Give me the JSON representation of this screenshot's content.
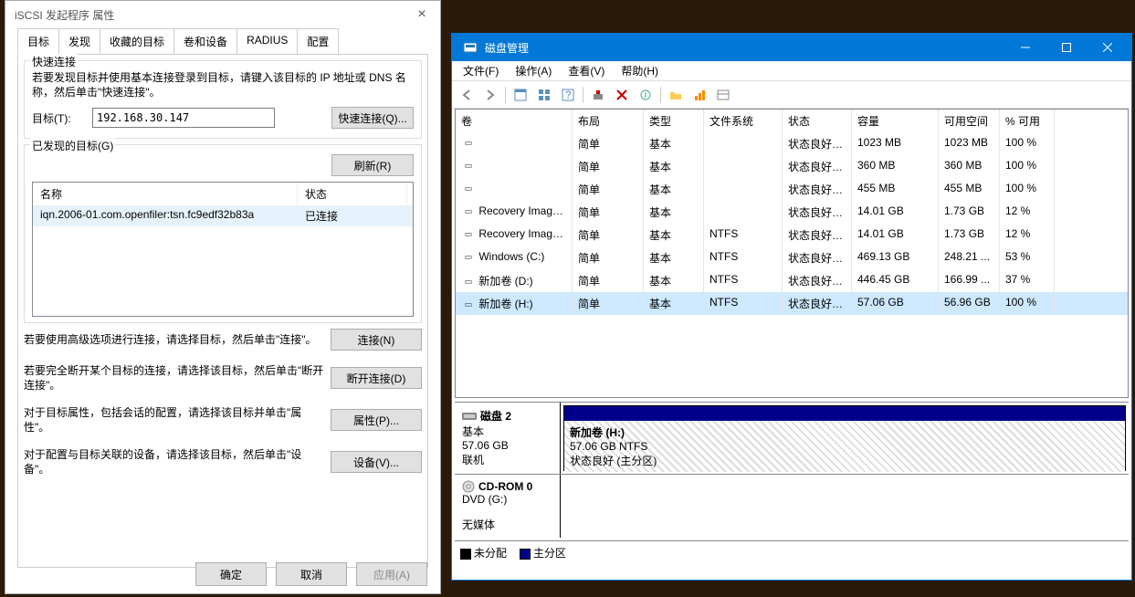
{
  "iscsi": {
    "title": "iSCSI 发起程序 属性",
    "tabs": [
      "目标",
      "发现",
      "收藏的目标",
      "卷和设备",
      "RADIUS",
      "配置"
    ],
    "quick_connect": {
      "group_title": "快速连接",
      "help": "若要发现目标并使用基本连接登录到目标，请键入该目标的 IP 地址或 DNS 名称，然后单击\"快速连接\"。",
      "target_label": "目标(T):",
      "target_value": "192.168.30.147",
      "quick_btn": "快速连接(Q)..."
    },
    "discovered": {
      "group_title": "已发现的目标(G)",
      "refresh_btn": "刷新(R)",
      "col_name": "名称",
      "col_status": "状态",
      "row_name": "iqn.2006-01.com.openfiler:tsn.fc9edf32b83a",
      "row_status": "已连接"
    },
    "actions": {
      "connect_help": "若要使用高级选项进行连接，请选择目标，然后单击\"连接\"。",
      "connect_btn": "连接(N)",
      "disconnect_help": "若要完全断开某个目标的连接，请选择该目标，然后单击\"断开连接\"。",
      "disconnect_btn": "断开连接(D)",
      "props_help": "对于目标属性，包括会话的配置，请选择该目标并单击\"属性\"。",
      "props_btn": "属性(P)...",
      "devices_help": "对于配置与目标关联的设备，请选择该目标，然后单击\"设备\"。",
      "devices_btn": "设备(V)..."
    },
    "footer": {
      "ok": "确定",
      "cancel": "取消",
      "apply": "应用(A)"
    }
  },
  "dm": {
    "title": "磁盘管理",
    "menus": [
      "文件(F)",
      "操作(A)",
      "查看(V)",
      "帮助(H)"
    ],
    "cols": [
      "卷",
      "布局",
      "类型",
      "文件系统",
      "状态",
      "容量",
      "可用空间",
      "% 可用"
    ],
    "rows": [
      {
        "vol": "",
        "layout": "简单",
        "type": "基本",
        "fs": "",
        "status": "状态良好 (...",
        "cap": "1023 MB",
        "free": "1023 MB",
        "pct": "100 %"
      },
      {
        "vol": "",
        "layout": "简单",
        "type": "基本",
        "fs": "",
        "status": "状态良好 (...",
        "cap": "360 MB",
        "free": "360 MB",
        "pct": "100 %"
      },
      {
        "vol": "",
        "layout": "简单",
        "type": "基本",
        "fs": "",
        "status": "状态良好 (...",
        "cap": "455 MB",
        "free": "455 MB",
        "pct": "100 %"
      },
      {
        "vol": "Recovery Image ...",
        "layout": "简单",
        "type": "基本",
        "fs": "",
        "status": "状态良好 (...",
        "cap": "14.01 GB",
        "free": "1.73 GB",
        "pct": "12 %"
      },
      {
        "vol": "Recovery Image ...",
        "layout": "简单",
        "type": "基本",
        "fs": "NTFS",
        "status": "状态良好 (...",
        "cap": "14.01 GB",
        "free": "1.73 GB",
        "pct": "12 %"
      },
      {
        "vol": "Windows (C:)",
        "layout": "简单",
        "type": "基本",
        "fs": "NTFS",
        "status": "状态良好 (...",
        "cap": "469.13 GB",
        "free": "248.21 ...",
        "pct": "53 %"
      },
      {
        "vol": "新加卷 (D:)",
        "layout": "简单",
        "type": "基本",
        "fs": "NTFS",
        "status": "状态良好 (...",
        "cap": "446.45 GB",
        "free": "166.99 ...",
        "pct": "37 %"
      },
      {
        "vol": "新加卷 (H:)",
        "layout": "简单",
        "type": "基本",
        "fs": "NTFS",
        "status": "状态良好 (...",
        "cap": "57.06 GB",
        "free": "56.96 GB",
        "pct": "100 %"
      }
    ],
    "disk2": {
      "name": "磁盘 2",
      "kind": "基本",
      "size": "57.06 GB",
      "state": "联机",
      "part_name": "新加卷 (H:)",
      "part_size": "57.06 GB NTFS",
      "part_status": "状态良好 (主分区)"
    },
    "cdrom": {
      "name": "CD-ROM 0",
      "drive": "DVD (G:)",
      "state": "无媒体"
    },
    "legend": {
      "unalloc": "未分配",
      "primary": "主分区"
    }
  }
}
